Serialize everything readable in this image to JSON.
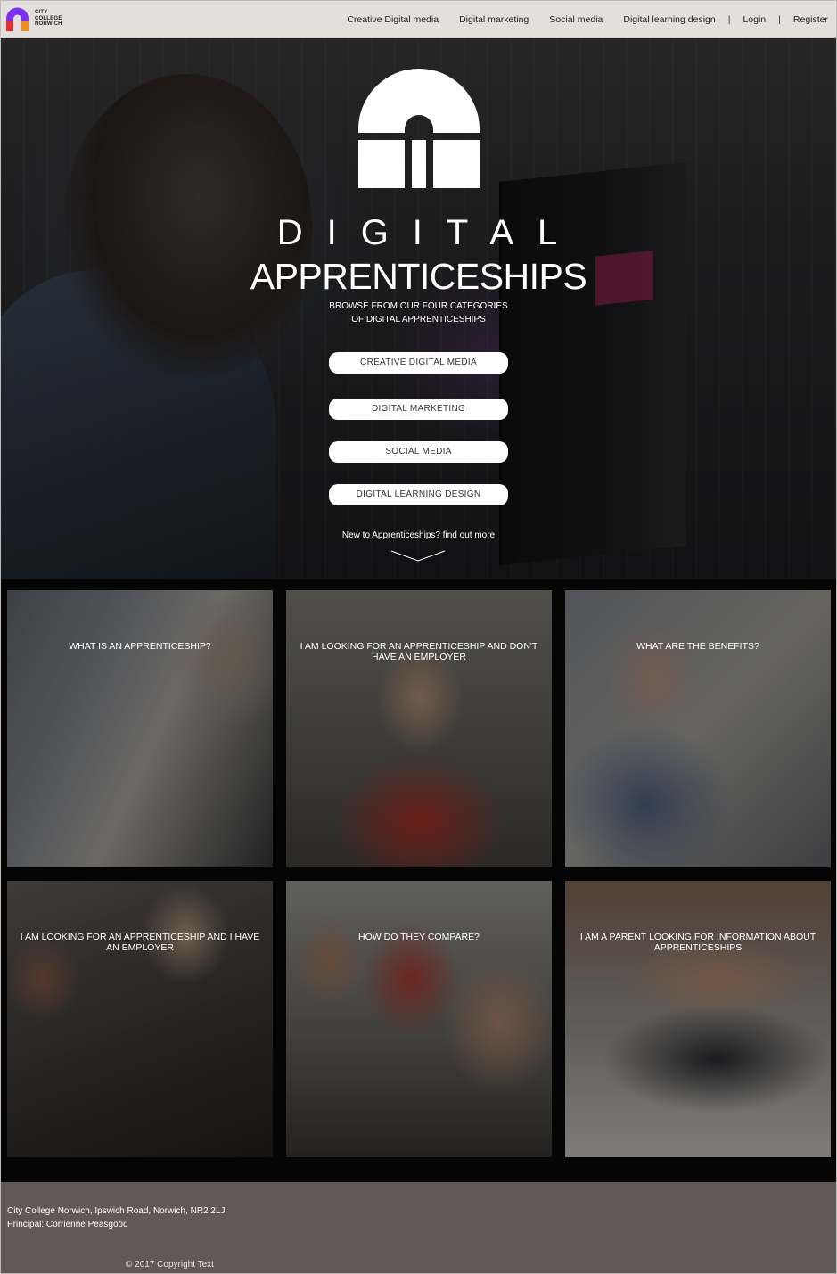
{
  "header": {
    "logo_text": [
      "CITY",
      "COLLEGE",
      "NORWICH"
    ],
    "nav": {
      "creative": "Creative Digital media",
      "marketing": "Digital marketing",
      "social": "Social media",
      "learning": "Digital learning design",
      "sep": "|",
      "login": "Login",
      "register": "Register"
    }
  },
  "hero": {
    "title_line1": "DIGITAL",
    "title_line2": "APPRENTICESHIPS",
    "browse_line1": "BROWSE FROM OUR FOUR CATEGORIES",
    "browse_line2": "OF DIGITAL APPRENTICESHIPS",
    "buttons": {
      "creative": "CREATIVE DIGITAL MEDIA",
      "marketing": "DIGITAL MARKETING",
      "social": "SOCIAL MEDIA",
      "learning": "DIGITAL LEARNING DESIGN"
    },
    "new_to": "New to Apprenticeships? find out more"
  },
  "tiles": [
    {
      "caption": "WHAT IS AN APPRENTICESHIP?"
    },
    {
      "caption": "I AM LOOKING FOR AN APPRENTICESHIP AND DON'T HAVE AN EMPLOYER"
    },
    {
      "caption": "WHAT ARE THE BENEFITS?"
    },
    {
      "caption": "I AM LOOKING FOR AN APPRENTICESHIP AND I HAVE AN EMPLOYER"
    },
    {
      "caption": "HOW DO THEY COMPARE?"
    },
    {
      "caption": "I AM A PARENT LOOKING FOR INFORMATION ABOUT APPRENTICESHIPS"
    }
  ],
  "footer": {
    "address": "City College Norwich, Ipswich Road, Norwich, NR2 2LJ",
    "principal": "Principal: Corrienne Peasgood",
    "copyright": "© 2017 Copyright Text"
  },
  "colors": {
    "header_bg": "#e3dfdc",
    "footer_bg": "#625856",
    "logo_purple": "#7b2ff0",
    "logo_red": "#e53030",
    "logo_orange": "#f08a1e"
  }
}
